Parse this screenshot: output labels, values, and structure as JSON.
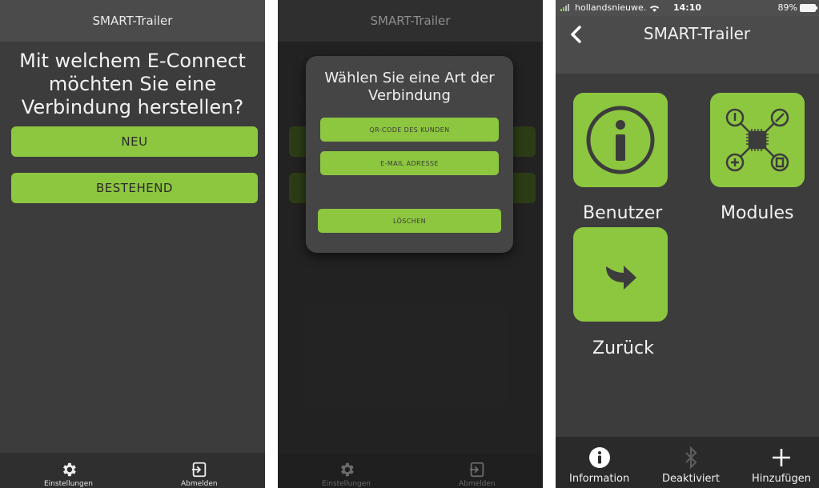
{
  "app_title": "SMART-Trailer",
  "screen1": {
    "question": "Mit welchem E-Connect möchten Sie eine Verbindung herstellen?",
    "btn_new": "NEU",
    "btn_existing": "BESTEHEND"
  },
  "bottom_tabs": {
    "settings": "Einstellungen",
    "logout": "Abmelden"
  },
  "dialog": {
    "title": "Wählen Sie eine Art der Verbindung",
    "opt_qr": "QR-CODE DES KUNDEN",
    "opt_email": "E-MAIL ADRESSE",
    "opt_delete": "LÖSCHEN"
  },
  "screen3": {
    "status": {
      "carrier": "hollandsnieuwe.",
      "time": "14:10",
      "battery": "89%"
    },
    "title": "SMART-Trailer",
    "tiles": {
      "user": "Benutzer",
      "modules": "Modules",
      "back": "Zurück"
    },
    "tabs": {
      "information": "Information",
      "bluetooth": "Deaktiviert",
      "add": "Hinzufügen"
    }
  },
  "colors": {
    "accent": "#8dc63f",
    "background": "#3c3c3c",
    "bar": "#4b4b4b"
  },
  "icons": [
    "gear-icon",
    "logout-icon",
    "info-icon",
    "chip-icon",
    "arrow-icon",
    "bluetooth-icon",
    "plus-icon",
    "back-chevron-icon",
    "wifi-icon",
    "signal-icon",
    "battery-icon"
  ]
}
